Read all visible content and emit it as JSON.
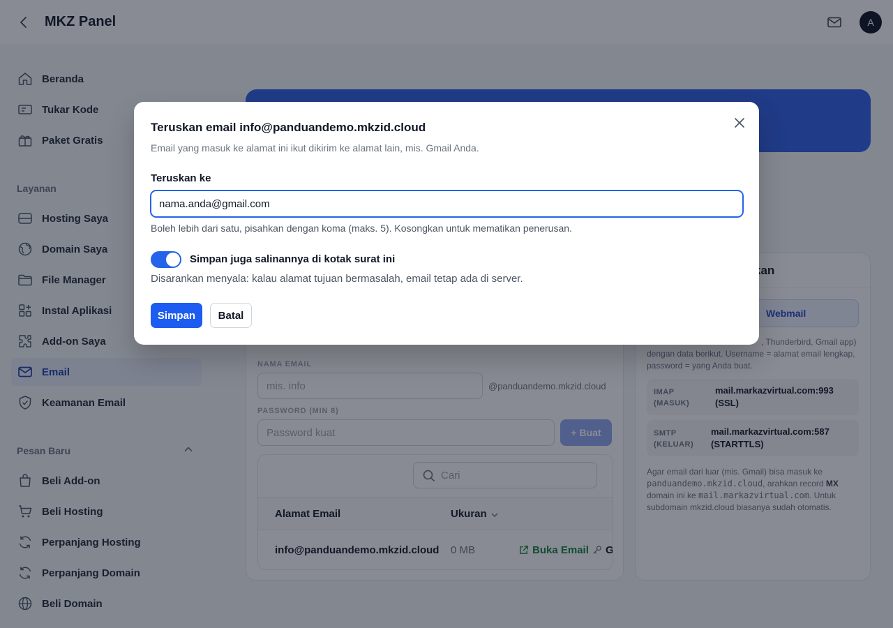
{
  "header": {
    "title": "MKZ Panel",
    "avatar_initial": "A"
  },
  "sidebar": {
    "main_items": [
      {
        "label": "Beranda",
        "icon": "home-icon"
      },
      {
        "label": "Tukar Kode",
        "icon": "ticket-icon"
      },
      {
        "label": "Paket Gratis",
        "icon": "gift-icon"
      }
    ],
    "section_layanan": "Layanan",
    "layanan_items": [
      {
        "label": "Hosting Saya",
        "icon": "server-icon"
      },
      {
        "label": "Domain Saya",
        "icon": "globe-icon"
      },
      {
        "label": "File Manager",
        "icon": "folder-icon"
      },
      {
        "label": "Instal Aplikasi",
        "icon": "apps-icon"
      },
      {
        "label": "Add-on Saya",
        "icon": "puzzle-icon"
      },
      {
        "label": "Email",
        "icon": "mail-icon",
        "active": true
      },
      {
        "label": "Keamanan Email",
        "icon": "shield-icon"
      }
    ],
    "section_pesan": "Pesan Baru",
    "pesan_items": [
      {
        "label": "Beli Add-on",
        "icon": "bag-icon"
      },
      {
        "label": "Beli Hosting",
        "icon": "cart-icon"
      },
      {
        "label": "Perpanjang Hosting",
        "icon": "refresh-icon"
      },
      {
        "label": "Perpanjang Domain",
        "icon": "refresh-icon"
      },
      {
        "label": "Beli Domain",
        "icon": "globe-icon"
      }
    ]
  },
  "background": {
    "right_card_title_partial": "kan",
    "webmail_button_partial": "Webmail",
    "info_line1_partial": ", Thunderbird, Gmail app)",
    "info_line2": "dengan data berikut. Username = alamat email lengkap,",
    "info_line3": "password = yang Anda buat.",
    "imap_key": "IMAP",
    "imap_key2": "(MASUK)",
    "imap_value": "mail.markazvirtual.com:993",
    "imap_value2": "(SSL)",
    "smtp_key": "SMTP",
    "smtp_key2": "(KELUAR)",
    "smtp_value": "mail.markazvirtual.com:587",
    "smtp_value2": "(STARTTLS)",
    "mx_note_1": "Agar email dari luar (mis. Gmail) bisa masuk ke",
    "mx_note_domain": "panduandemo.mkzid.cloud",
    "mx_note_2": ", arahkan record ",
    "mx_note_mx": "MX",
    "mx_note_3": "domain ini ke ",
    "mx_note_host": "mail.markazvirtual.com",
    "mx_note_4": ". Untuk",
    "mx_note_5": "subdomain mkzid.cloud biasanya sudah otomatis.",
    "nama_email_label": "NAMA EMAIL",
    "nama_email_placeholder": "mis. info",
    "domain_suffix": "@panduandemo.mkzid.cloud",
    "password_label": "PASSWORD (MIN 8)",
    "password_placeholder": "Password kuat",
    "buat_button": "+ Buat",
    "search_placeholder": "Cari",
    "col_address": "Alamat Email",
    "col_size": "Ukuran",
    "row_address": "info@panduandemo.mkzid.cloud",
    "row_size": "0 MB",
    "row_action_open": "Buka Email",
    "row_action_partial": "G"
  },
  "modal": {
    "title": "Teruskan email info@panduandemo.mkzid.cloud",
    "subtitle": "Email yang masuk ke alamat ini ikut dikirim ke alamat lain, mis. Gmail Anda.",
    "field_label": "Teruskan ke",
    "field_value": "nama.anda@gmail.com",
    "field_hint": "Boleh lebih dari satu, pisahkan dengan koma (maks. 5). Kosongkan untuk mematikan penerusan.",
    "toggle_on": true,
    "toggle_label": "Simpan juga salinannya di kotak surat ini",
    "toggle_hint": "Disarankan menyala: kalau alamat tujuan bermasalah, email tetap ada di server.",
    "save_button": "Simpan",
    "cancel_button": "Batal"
  },
  "colors": {
    "accent": "#2563eb",
    "primary_button": "#1d5cf0",
    "banner": "#2f5fe6"
  }
}
